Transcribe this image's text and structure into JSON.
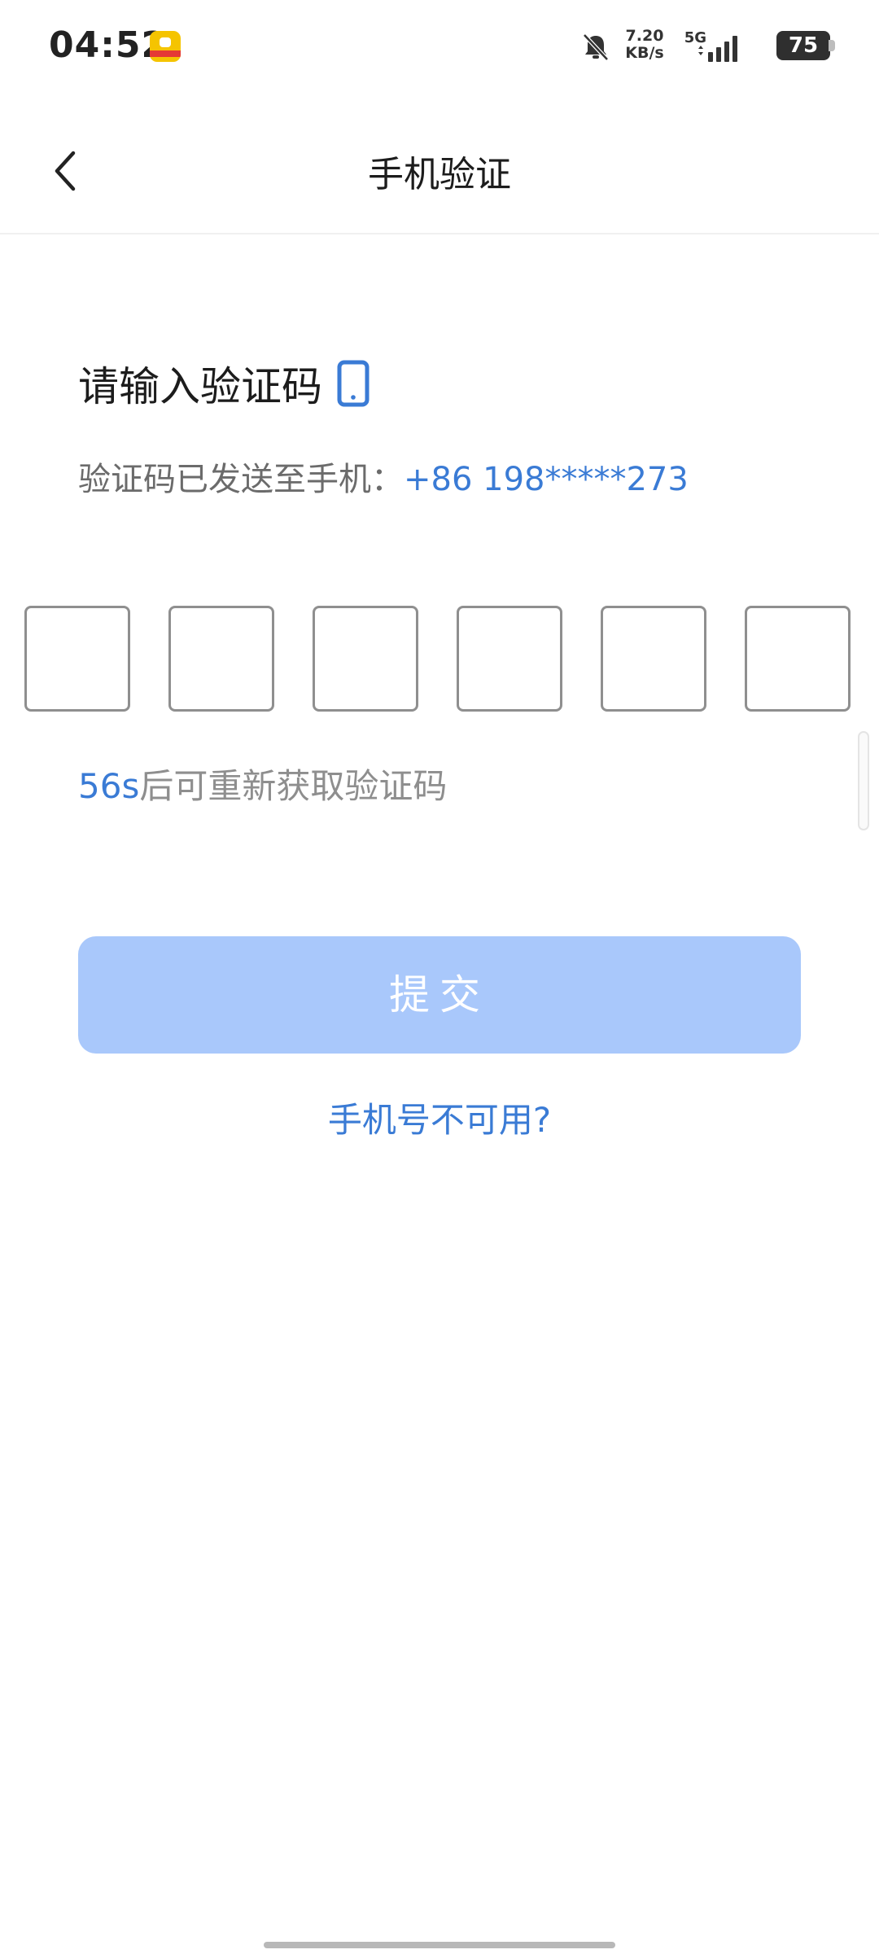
{
  "status_bar": {
    "time": "04:52",
    "net_speed_value": "7.20",
    "net_speed_unit": "KB/s",
    "network_type": "5G",
    "battery_level": "75",
    "icons": [
      "app-badge-icon",
      "bell-muted-icon",
      "signal-icon",
      "battery-icon"
    ]
  },
  "nav": {
    "title": "手机验证",
    "back_icon": "chevron-left-icon"
  },
  "verify": {
    "prompt": "请输入验证码",
    "prompt_icon": "smartphone-icon",
    "sent_label": "验证码已发送至手机：",
    "phone_number": "+86 198*****273",
    "code_digits": [
      "",
      "",
      "",
      "",
      "",
      ""
    ],
    "countdown": "56s",
    "resend_label": "后可重新获取验证码"
  },
  "actions": {
    "submit_label": "提交",
    "phone_unavailable_label": "手机号不可用?"
  },
  "colors": {
    "accent": "#3a7bd5",
    "button_disabled": "#a9c8fb",
    "box_border": "#8f8f8f",
    "muted_text": "#8e8e8e"
  }
}
